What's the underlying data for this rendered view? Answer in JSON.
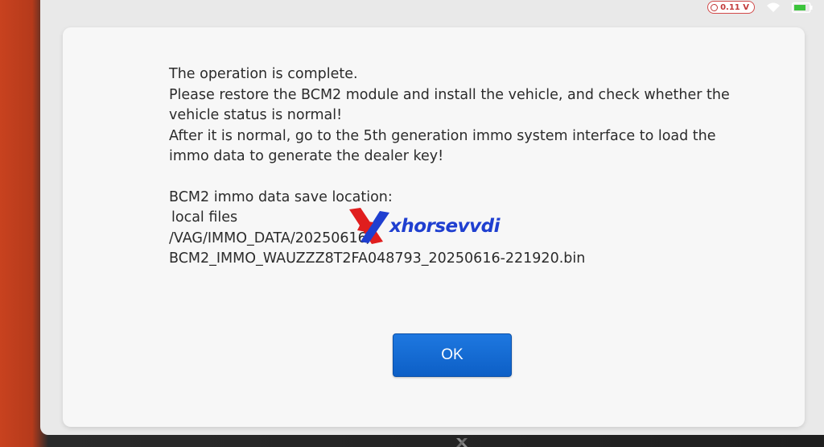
{
  "statusbar": {
    "voltage": "0.11 V",
    "voltage_icon": "gauge-icon",
    "wifi_icon": "wifi-icon",
    "battery_icon": "battery-icon",
    "colors": {
      "voltage": "#c23b3b",
      "battery": "#3cc43c"
    }
  },
  "dialog": {
    "lines": [
      "The operation is complete.",
      "Please restore the BCM2 module and install the vehicle, and check whether the vehicle status is normal!",
      "After it is normal, go to the 5th generation immo system interface to load the immo data to generate the dealer key!"
    ],
    "location_label": "BCM2 immo data save location:",
    "storage": "local files",
    "path": "/VAG/IMMO_DATA/20250616/",
    "filename": "BCM2_IMMO_WAUZZZ8T2FA048793_20250616-221920.bin",
    "ok_label": "OK",
    "colors": {
      "ok_button": "#1a6fd8",
      "text": "#2b2b2b"
    }
  },
  "watermark": {
    "text": "xhorsevvdi",
    "logo_icon": "xhorse-x-logo-icon",
    "colors": {
      "logo": "#e01e1e",
      "text": "#1f3fd0"
    }
  }
}
